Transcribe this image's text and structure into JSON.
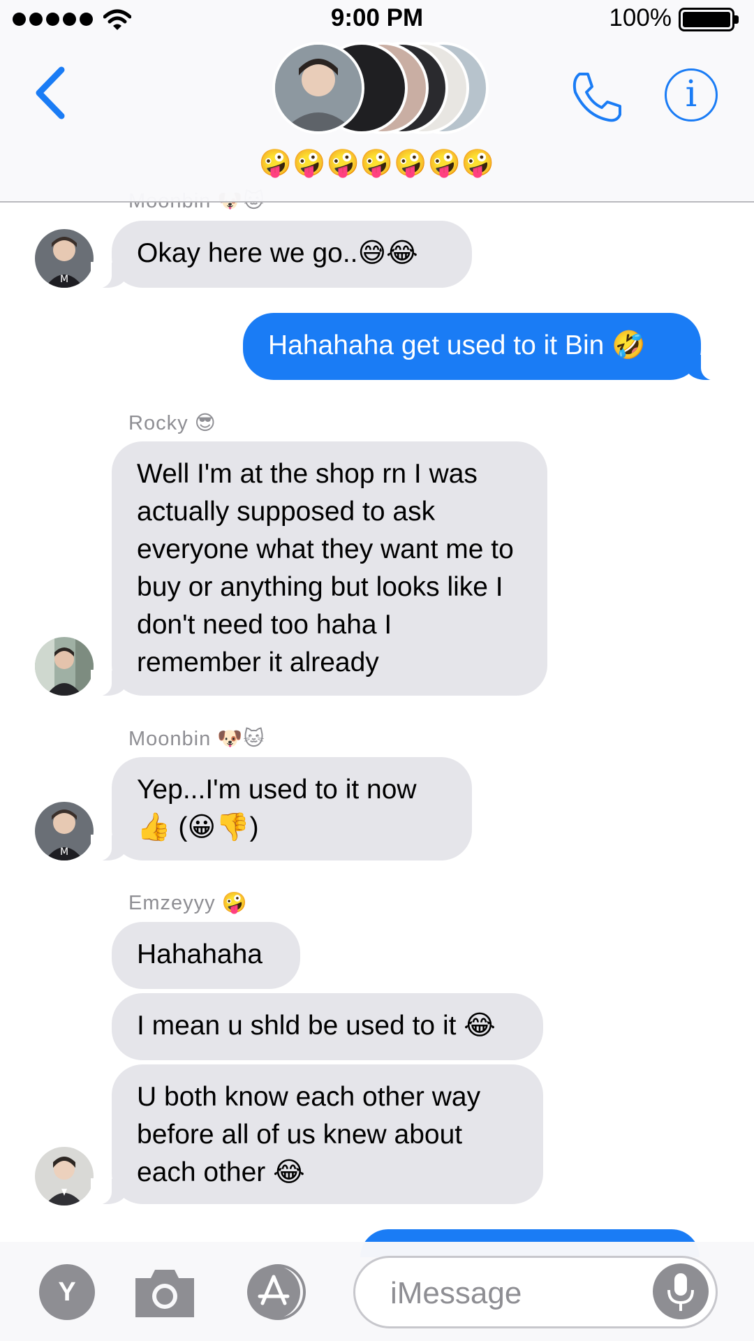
{
  "status_bar": {
    "time": "9:00 PM",
    "battery_percent": "100%",
    "battery_level": 1.0,
    "signal_bars": 5
  },
  "header": {
    "group_emojis": "🤪🤪🤪🤪🤪🤪🤪",
    "back_icon": "chevron-left-icon",
    "call_icon": "phone-icon",
    "info_icon": "info-icon",
    "info_glyph": "i",
    "accent_color": "#1a7cf5"
  },
  "messages": [
    {
      "sender": "Moonbin 🐶🐱",
      "direction": "incoming",
      "text": "Okay here we go..😅😂"
    },
    {
      "direction": "outgoing",
      "text": "Hahahaha get used to it Bin 🤣"
    },
    {
      "sender": "Rocky 😎",
      "direction": "incoming",
      "text": "Well I'm at the shop rn I was actually supposed to ask everyone what they want me to buy or anything but looks like I don't need too haha I remember it already"
    },
    {
      "sender": "Moonbin 🐶🐱",
      "direction": "incoming",
      "text": "Yep...I'm used to it now 👍 (😀👎)"
    },
    {
      "sender": "Emzeyyy 🤪",
      "direction": "incoming",
      "text": "Hahahaha"
    },
    {
      "direction": "incoming",
      "text": "I mean u shld be used to it 😂"
    },
    {
      "direction": "incoming",
      "text": "U both know each other way before all of us knew about each other 😂"
    }
  ],
  "bottom_bar": {
    "y_label": "Y",
    "placeholder": "iMessage",
    "camera_icon": "camera-icon",
    "apps_icon": "app-store-icon",
    "mic_icon": "microphone-icon"
  },
  "colors": {
    "outgoing_bubble": "#1a7cf5",
    "incoming_bubble": "#e5e5ea",
    "sender_text": "#8e8e93"
  }
}
